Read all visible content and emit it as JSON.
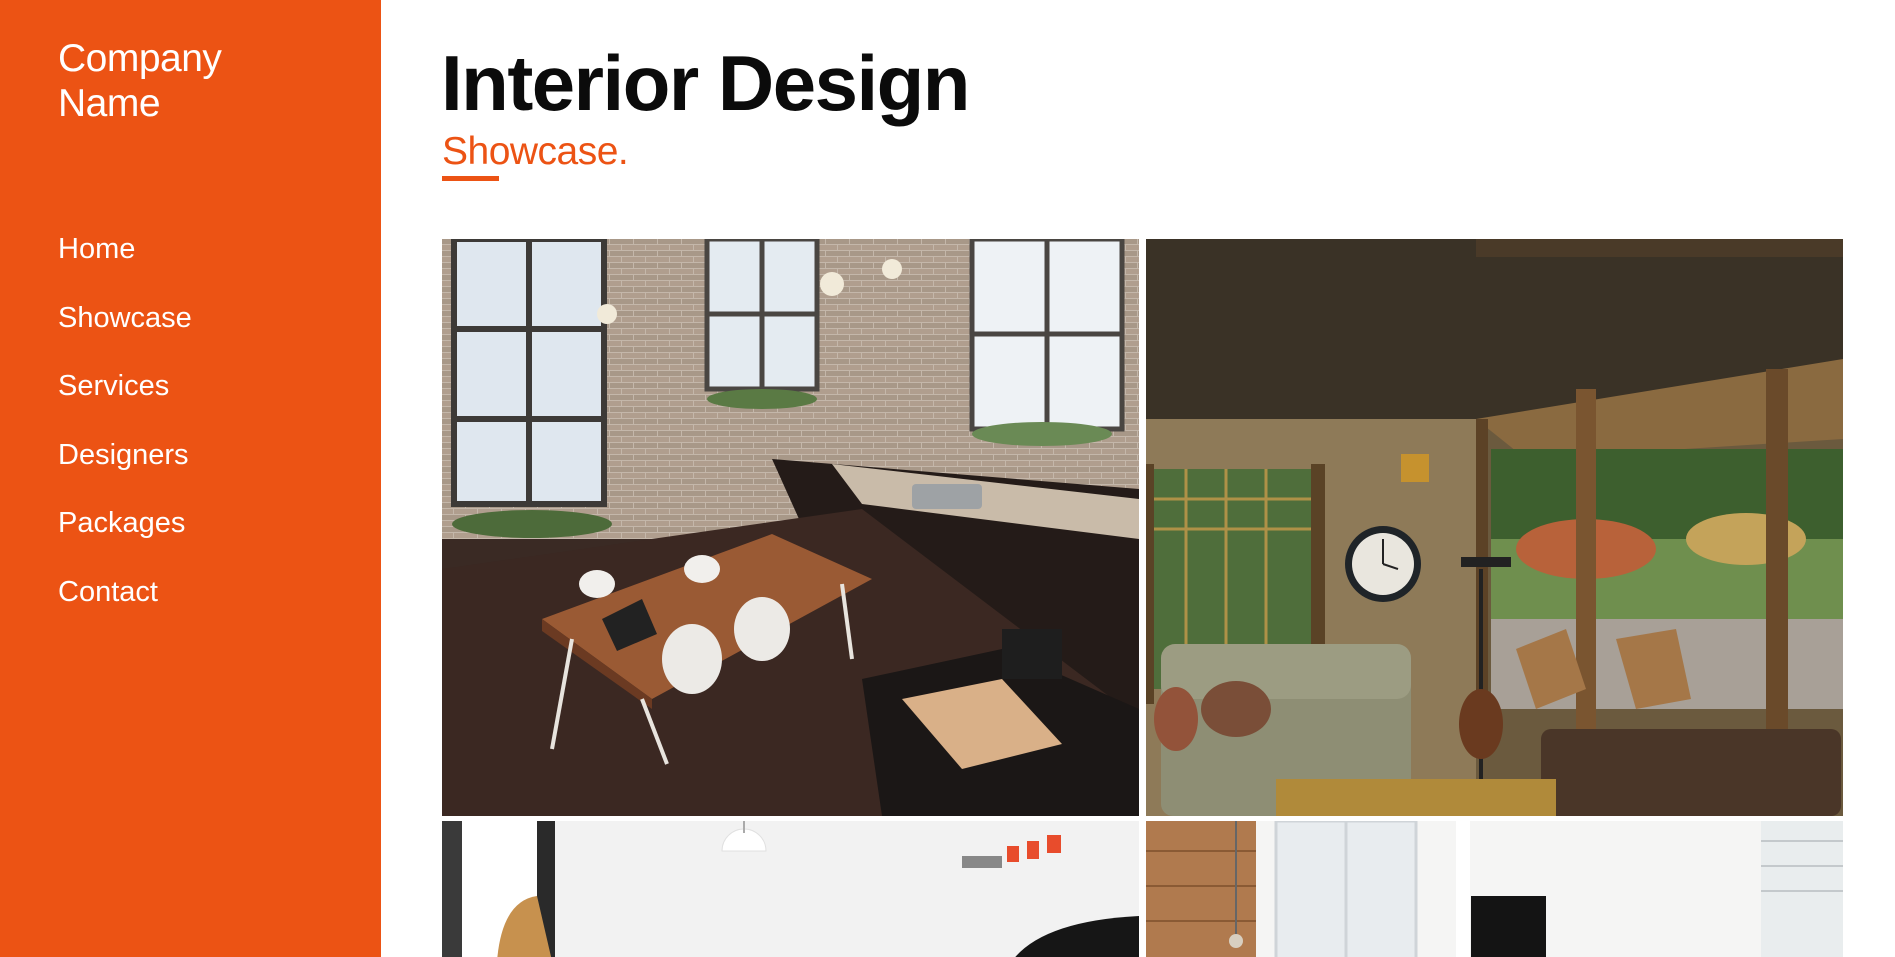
{
  "sidebar": {
    "brand": "Company\nName",
    "brand_line1": "Company",
    "brand_line2": "Name",
    "items": [
      {
        "label": "Home"
      },
      {
        "label": "Showcase"
      },
      {
        "label": "Services"
      },
      {
        "label": "Designers"
      },
      {
        "label": "Packages"
      },
      {
        "label": "Contact"
      }
    ]
  },
  "header": {
    "title": "Interior Design",
    "subtitle": "Showcase."
  },
  "gallery": {
    "images": [
      {
        "name": "loft-kitchen-dining-photo"
      },
      {
        "name": "covered-porch-living-room-photo"
      },
      {
        "name": "white-room-chair-lamp-photo"
      },
      {
        "name": "bright-office-monitor-photo"
      }
    ]
  },
  "colors": {
    "accent": "#ec5314",
    "sidebar_text": "#ffffff",
    "title": "#0b0b0b"
  }
}
